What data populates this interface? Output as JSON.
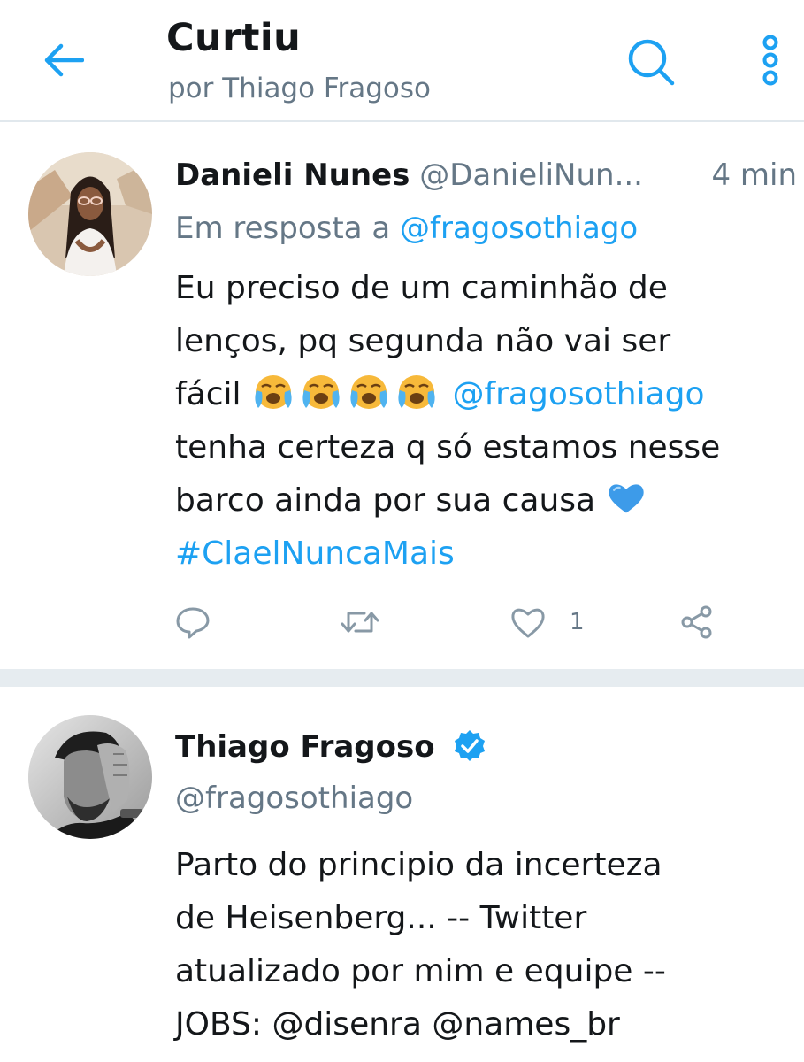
{
  "header": {
    "title": "Curtiu",
    "subtitle": "por Thiago Fragoso"
  },
  "colors": {
    "accent": "#1da1f2",
    "secondary_text": "#657786",
    "separator": "#e6ecf0",
    "verified": "#1da1f2",
    "heart_emoji": "#3d9be9"
  },
  "tweets": [
    {
      "display_name": "Danieli Nunes",
      "handle": "@DanieliNun...",
      "time": "4 min",
      "reply_prefix": "Em resposta a",
      "reply_to": "@fragosothiago",
      "text_line1": "Eu preciso de um caminhão de",
      "text_line2": "lenços, pq segunda não vai ser",
      "text_line3_start": "fácil",
      "text_line3_mention": "@fragosothiago",
      "text_line4": "tenha certeza q só estamos nesse",
      "text_line5": "barco ainda por sua causa",
      "hashtag": "#ClaelNuncaMais",
      "like_count": "1",
      "icons": [
        "reply-icon",
        "retweet-icon",
        "like-icon",
        "share-icon"
      ]
    },
    {
      "display_name": "Thiago Fragoso",
      "handle": "@fragosothiago",
      "verified": true,
      "bio_line1": "Parto do principio da incerteza",
      "bio_line2": "de Heisenberg... -- Twitter",
      "bio_line3": "atualizado por mim e equipe --",
      "bio_line4_prefix": "JOBS:",
      "bio_mention1": "@disenra",
      "bio_mention2": "@names_br"
    }
  ]
}
